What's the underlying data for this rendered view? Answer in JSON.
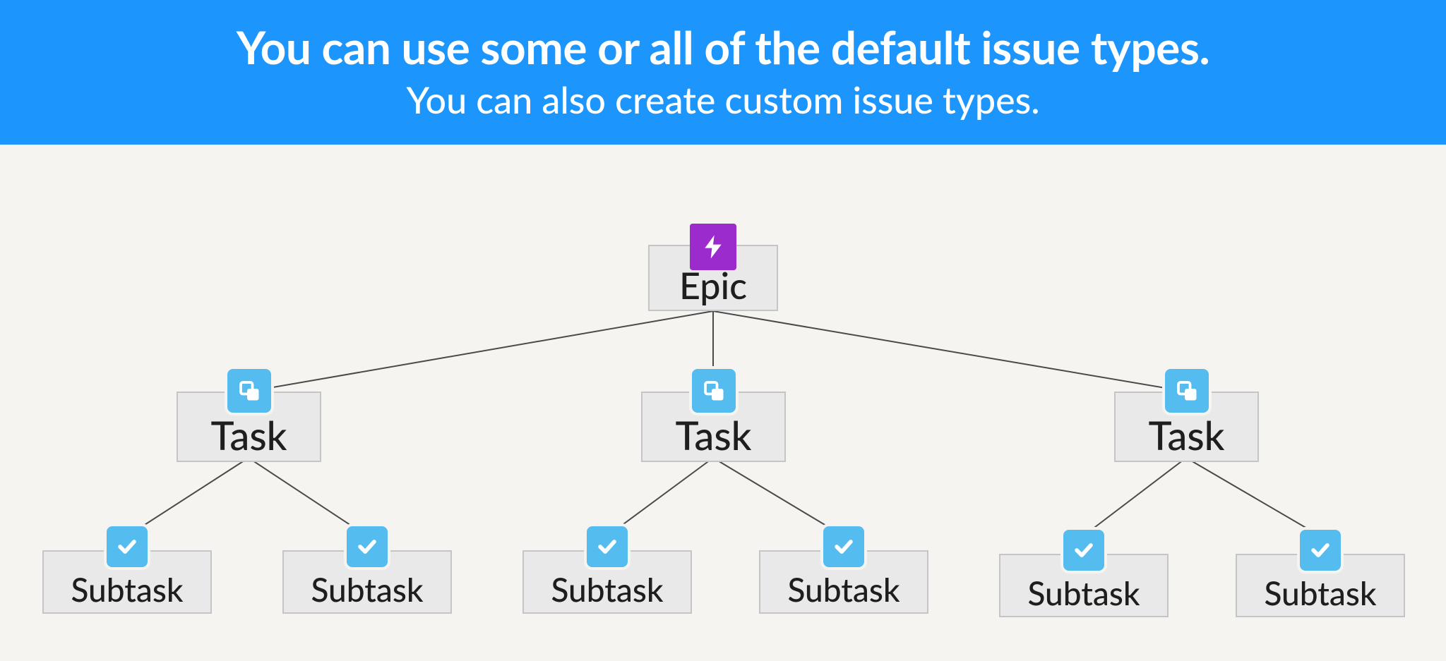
{
  "header": {
    "line1": "You can use some or all of the default issue types.",
    "line2": "You can also create custom issue types."
  },
  "colors": {
    "banner": "#1c95fc",
    "epic_icon": "#9b2bcc",
    "task_icon": "#55bcf0",
    "subtask_icon": "#55bcf0",
    "node_bg": "#e9e9e9",
    "node_border": "#c5c5c5",
    "page_bg": "#f5f4f0"
  },
  "hierarchy": {
    "epic": {
      "label": "Epic",
      "icon": "bolt-icon",
      "children": [
        {
          "label": "Task",
          "icon": "copy-icon",
          "children": [
            {
              "label": "Subtask",
              "icon": "check-icon"
            },
            {
              "label": "Subtask",
              "icon": "check-icon"
            }
          ]
        },
        {
          "label": "Task",
          "icon": "copy-icon",
          "children": [
            {
              "label": "Subtask",
              "icon": "check-icon"
            },
            {
              "label": "Subtask",
              "icon": "check-icon"
            }
          ]
        },
        {
          "label": "Task",
          "icon": "copy-icon",
          "children": [
            {
              "label": "Subtask",
              "icon": "check-icon"
            },
            {
              "label": "Subtask",
              "icon": "check-icon"
            }
          ]
        }
      ]
    }
  }
}
